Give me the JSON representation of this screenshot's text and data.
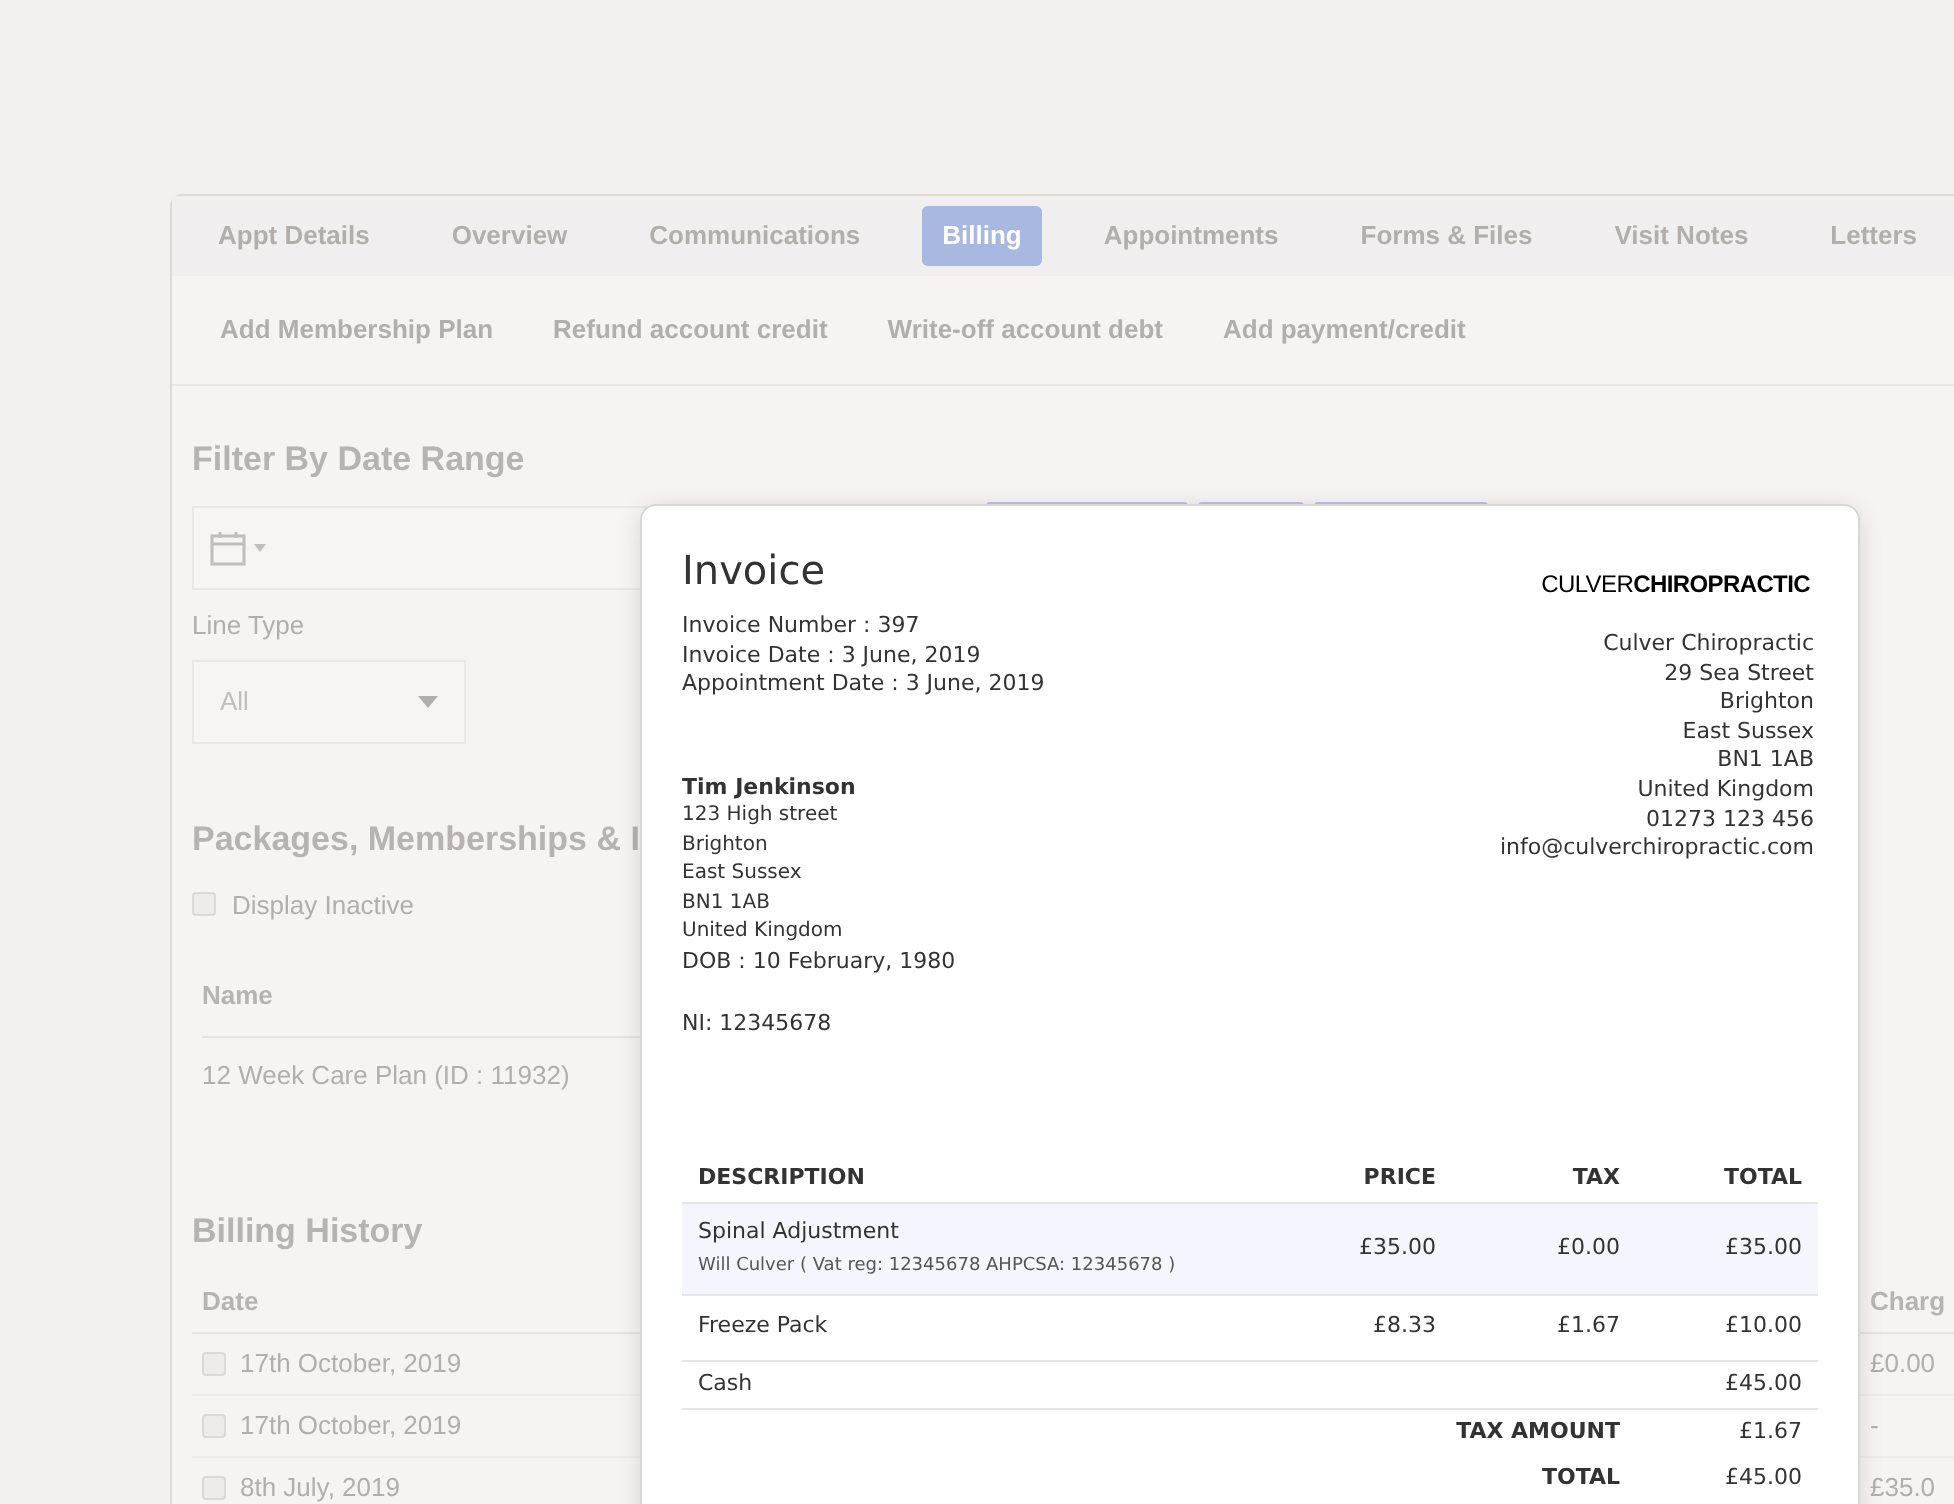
{
  "tabs": [
    {
      "label": "Appt Details",
      "selected": false
    },
    {
      "label": "Overview",
      "selected": false
    },
    {
      "label": "Communications",
      "selected": false
    },
    {
      "label": "Billing",
      "selected": true
    },
    {
      "label": "Appointments",
      "selected": false
    },
    {
      "label": "Forms & Files",
      "selected": false
    },
    {
      "label": "Visit Notes",
      "selected": false
    },
    {
      "label": "Letters",
      "selected": false
    }
  ],
  "actions": [
    "Add Membership Plan",
    "Refund account credit",
    "Write-off account debt",
    "Add payment/credit"
  ],
  "filter": {
    "heading": "Filter By Date Range",
    "line_type_label": "Line Type",
    "line_type_value": "All"
  },
  "packages": {
    "heading": "Packages, Memberships & I",
    "display_inactive": {
      "label": "Display Inactive",
      "checked": false
    },
    "column": "Name",
    "rows": [
      "12 Week Care Plan (ID : 11932)"
    ]
  },
  "billing_history": {
    "heading": "Billing History",
    "columns": [
      "Date",
      "Charg"
    ],
    "rows": [
      {
        "date": "17th October, 2019",
        "charge": "£0.00",
        "checked": false
      },
      {
        "date": "17th October, 2019",
        "charge": "-",
        "checked": false
      },
      {
        "date": "8th July, 2019",
        "charge": "£35.0",
        "checked": false
      }
    ]
  },
  "invoice": {
    "title": "Invoice",
    "meta": [
      "Invoice Number : 397",
      "Invoice Date : 3 June, 2019",
      "Appointment Date : 3 June, 2019"
    ],
    "logo": {
      "light": "CULVER",
      "bold": "CHIROPRACTIC"
    },
    "clinic_address": [
      "Culver Chiropractic",
      "29 Sea Street",
      "Brighton",
      "East Sussex",
      "BN1 1AB",
      "United Kingdom",
      "01273 123 456",
      "info@culverchiropractic.com"
    ],
    "patient": {
      "name": "Tim Jenkinson",
      "address": [
        "123 High street",
        "Brighton",
        "East Sussex",
        "BN1 1AB",
        "United Kingdom",
        "DOB : 10 February, 1980"
      ],
      "ni": "NI: 12345678"
    },
    "columns": [
      "DESCRIPTION",
      "PRICE",
      "TAX",
      "TOTAL"
    ],
    "items": [
      {
        "kind": "line",
        "description": "Spinal Adjustment",
        "detail": "Will Culver ( Vat reg: 12345678 AHPCSA: 12345678 )",
        "price": "£35.00",
        "tax": "£0.00",
        "total": "£35.00",
        "highlighted": true
      },
      {
        "kind": "line",
        "description": "Freeze Pack",
        "price": "£8.33",
        "tax": "£1.67",
        "total": "£10.00",
        "highlighted": false
      },
      {
        "kind": "payment",
        "description": "Cash",
        "total": "£45.00",
        "highlighted": false
      }
    ],
    "summary": [
      {
        "label": "TAX AMOUNT",
        "value": "£1.67"
      },
      {
        "label": "TOTAL",
        "value": "£45.00"
      }
    ]
  }
}
